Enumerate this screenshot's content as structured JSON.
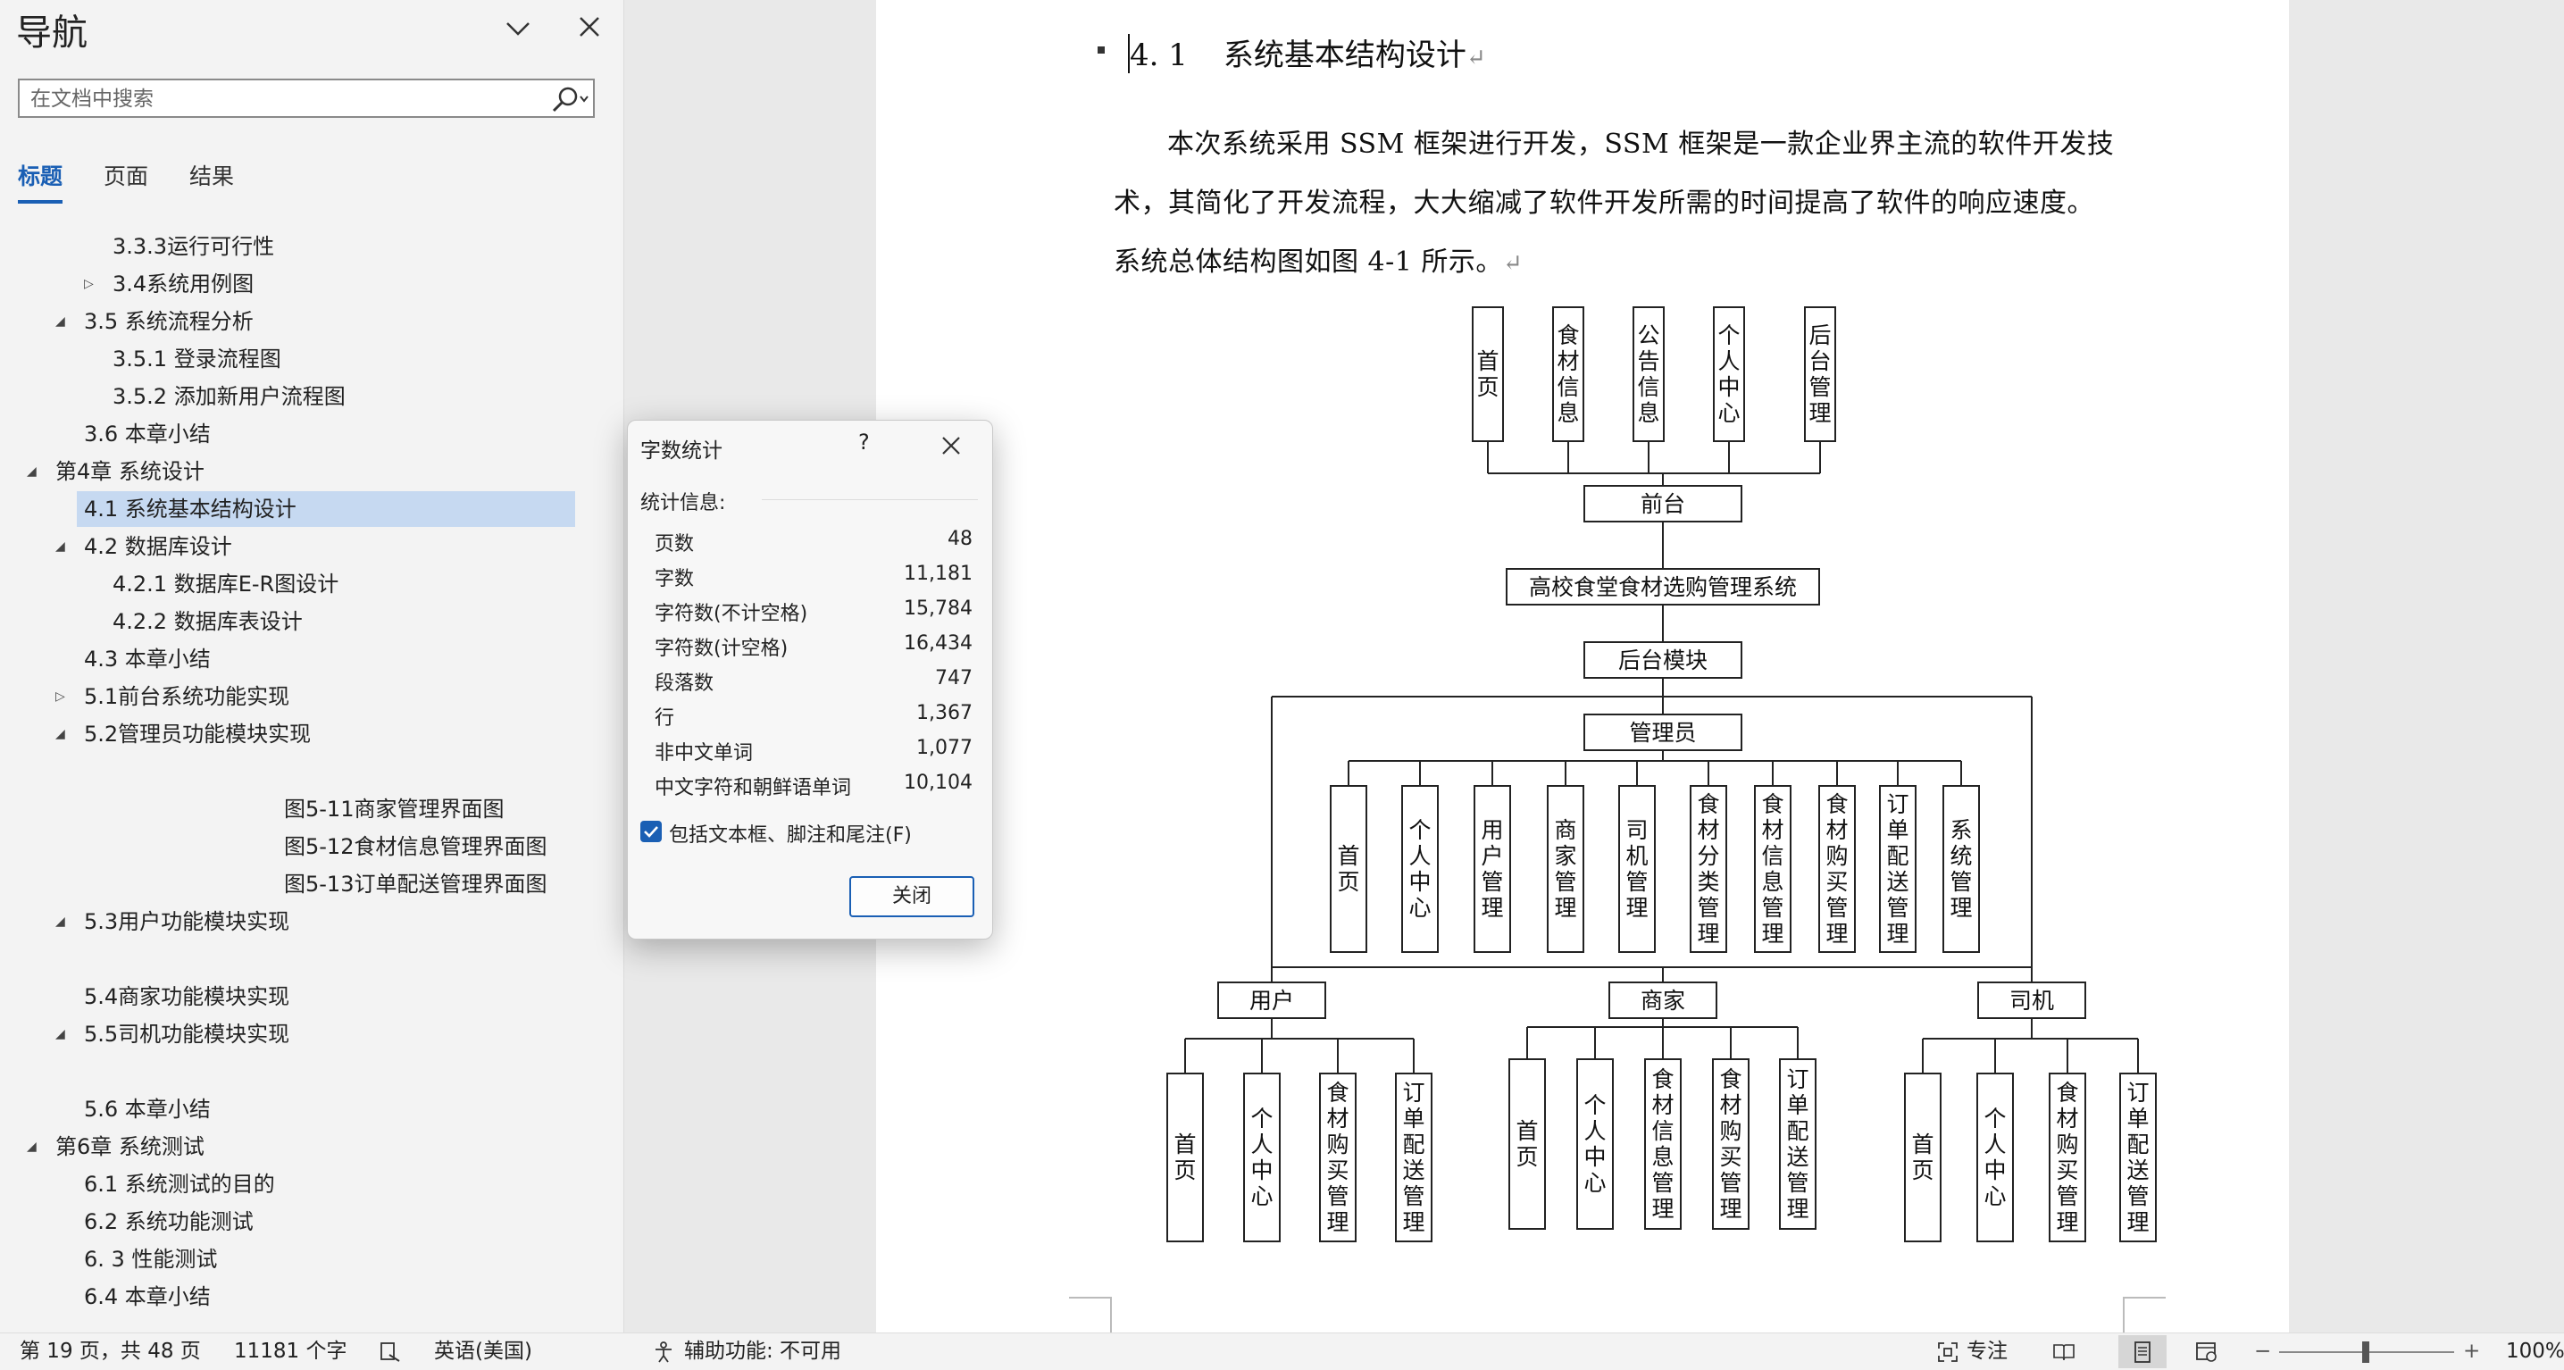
{
  "nav": {
    "title": "导航",
    "search_placeholder": "在文档中搜索",
    "tabs": [
      "标题",
      "页面",
      "结果"
    ],
    "outline": [
      {
        "text": "3.3.3运行可行性"
      },
      {
        "text": "3.4系统用例图"
      },
      {
        "text": "3.5 系统流程分析"
      },
      {
        "text": "3.5.1 登录流程图"
      },
      {
        "text": "3.5.2 添加新用户流程图"
      },
      {
        "text": "3.6 本章小结"
      },
      {
        "text": "第4章 系统设计"
      },
      {
        "text": "4.1 系统基本结构设计"
      },
      {
        "text": "4.2 数据库设计"
      },
      {
        "text": "4.2.1 数据库E-R图设计"
      },
      {
        "text": "4.2.2 数据库表设计"
      },
      {
        "text": "4.3 本章小结"
      },
      {
        "text": "5.1前台系统功能实现"
      },
      {
        "text": "5.2管理员功能模块实现"
      },
      {
        "text": "图5-11商家管理界面图"
      },
      {
        "text": "图5-12食材信息管理界面图"
      },
      {
        "text": "图5-13订单配送管理界面图"
      },
      {
        "text": "5.3用户功能模块实现"
      },
      {
        "text": "5.4商家功能模块实现"
      },
      {
        "text": "5.5司机功能模块实现"
      },
      {
        "text": "5.6 本章小结"
      },
      {
        "text": "第6章 系统测试"
      },
      {
        "text": "6.1 系统测试的目的"
      },
      {
        "text": "6.2 系统功能测试"
      },
      {
        "text": "6. 3 性能测试"
      },
      {
        "text": "6.4 本章小结"
      }
    ]
  },
  "doc": {
    "heading_num": "4. 1",
    "heading_text": "系统基本结构设计",
    "para_mark": "↵",
    "para_lines": [
      "本次系统采用 SSM 框架进行开发，SSM 框架是一款企业界主流的软件开发技",
      "术，其简化了开发流程，大大缩减了软件开发所需的时间提高了软件的响应速度。",
      "系统总体结构图如图 4-1 所示。"
    ],
    "diagram": {
      "front_modules": [
        "首页",
        "食材信息",
        "公告信息",
        "个人中心",
        "后台管理"
      ],
      "front": "前台",
      "system": "高校食堂食材选购管理系统",
      "backend": "后台模块",
      "admin": "管理员",
      "admin_modules": [
        "首页",
        "个人中心",
        "用户管理",
        "商家管理",
        "司机管理",
        "食材分类管理",
        "食材信息管理",
        "食材购买管理",
        "订单配送管理",
        "系统管理"
      ],
      "user": "用户",
      "user_modules": [
        "首页",
        "个人中心",
        "食材购买管理",
        "订单配送管理"
      ],
      "merchant": "商家",
      "merchant_modules": [
        "首页",
        "个人中心",
        "食材信息管理",
        "食材购买管理",
        "订单配送管理"
      ],
      "driver": "司机",
      "driver_modules": [
        "首页",
        "个人中心",
        "食材购买管理",
        "订单配送管理"
      ]
    }
  },
  "dialog": {
    "title": "字数统计",
    "help": "?",
    "section": "统计信息:",
    "stats": [
      {
        "label": "页数",
        "value": "48"
      },
      {
        "label": "字数",
        "value": "11,181"
      },
      {
        "label": "字符数(不计空格)",
        "value": "15,784"
      },
      {
        "label": "字符数(计空格)",
        "value": "16,434"
      },
      {
        "label": "段落数",
        "value": "747"
      },
      {
        "label": "行",
        "value": "1,367"
      },
      {
        "label": "非中文单词",
        "value": "1,077"
      },
      {
        "label": "中文字符和朝鲜语单词",
        "value": "10,104"
      }
    ],
    "checkbox_label": "包括文本框、脚注和尾注(F)",
    "close_label": "关闭"
  },
  "status": {
    "page": "第 19 页，共 48 页",
    "words": "11181 个字",
    "language": "英语(美国)",
    "accessibility": "辅助功能: 不可用",
    "focus": "专注",
    "zoom_minus": "−",
    "zoom_plus": "+",
    "zoom": "100%"
  }
}
